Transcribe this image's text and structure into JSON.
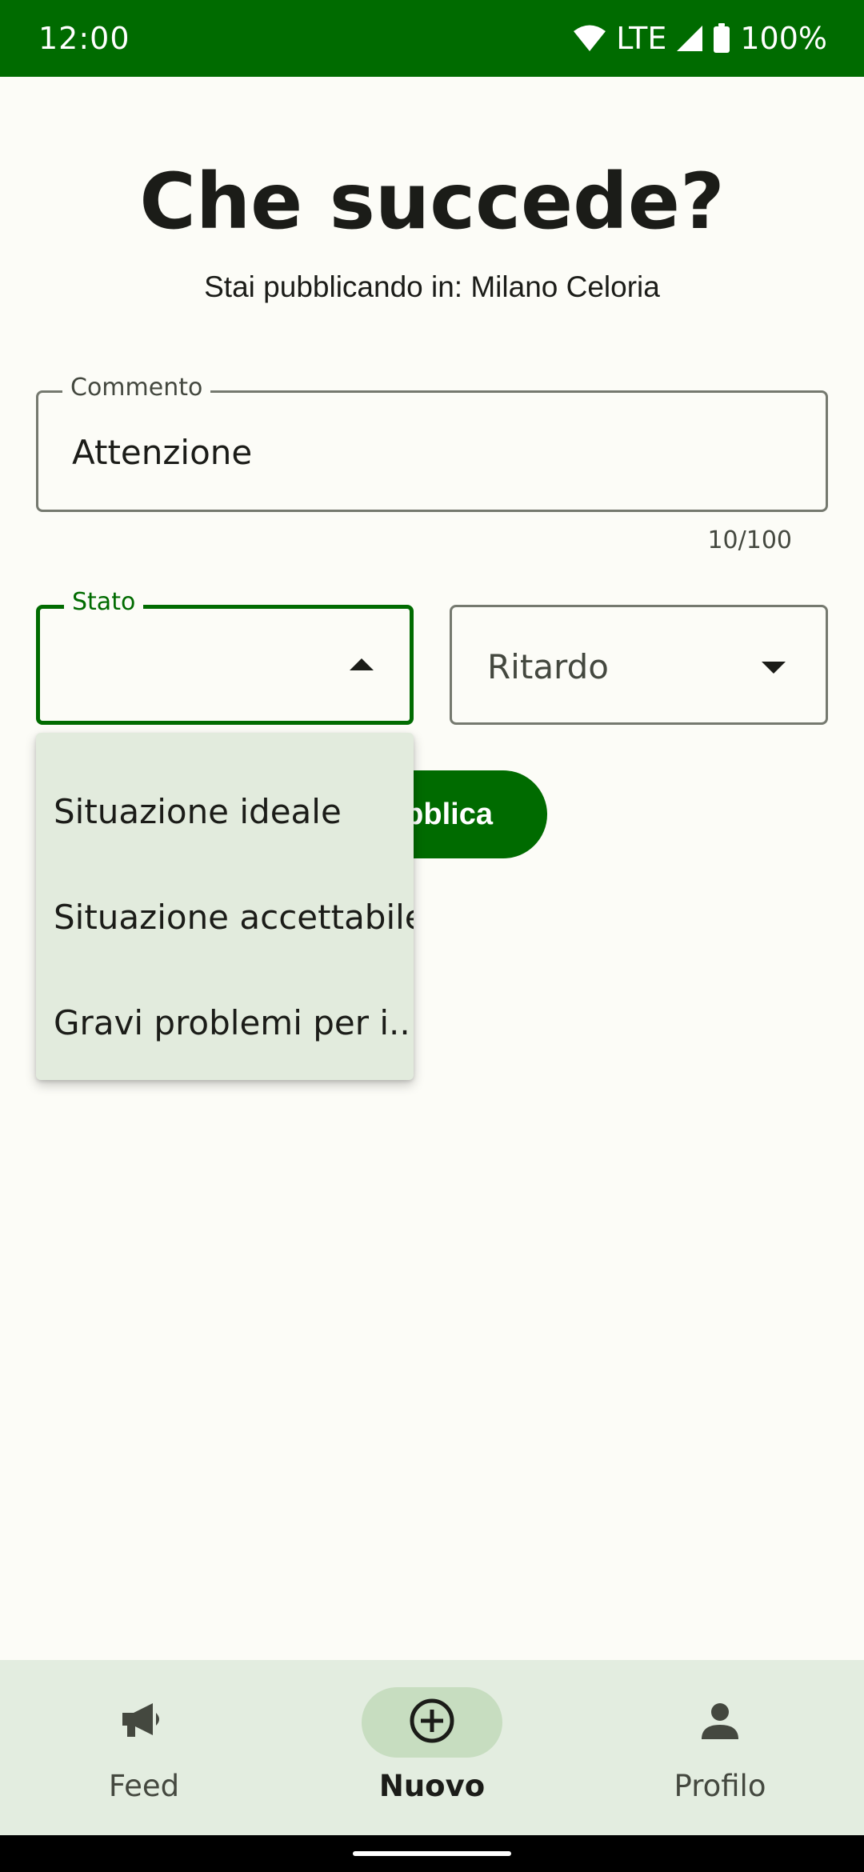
{
  "status_bar": {
    "time": "12:00",
    "network": "LTE",
    "battery": "100%"
  },
  "header": {
    "title": "Che succede?",
    "subtitle": "Stai pubblicando in: Milano Celoria"
  },
  "form": {
    "comment": {
      "label": "Commento",
      "value": "Attenzione",
      "counter": "10/100"
    },
    "stato": {
      "label": "Stato",
      "value": ""
    },
    "ritardo": {
      "value": "Ritardo"
    },
    "publish_label": "Pubblica"
  },
  "dropdown_menu": {
    "items": [
      "Situazione ideale",
      "Situazione accettabile",
      "Gravi problemi per i.."
    ]
  },
  "bottom_nav": {
    "items": [
      {
        "label": "Feed",
        "icon": "megaphone-icon",
        "active": false
      },
      {
        "label": "Nuovo",
        "icon": "add-circle-icon",
        "active": true
      },
      {
        "label": "Profilo",
        "icon": "person-icon",
        "active": false
      }
    ]
  },
  "colors": {
    "primary": "#006b00",
    "background": "#fcfcf7",
    "menu_bg": "#e2ebdd",
    "nav_bg": "#e3ede0",
    "nav_active_pill": "#c7ddc0"
  }
}
